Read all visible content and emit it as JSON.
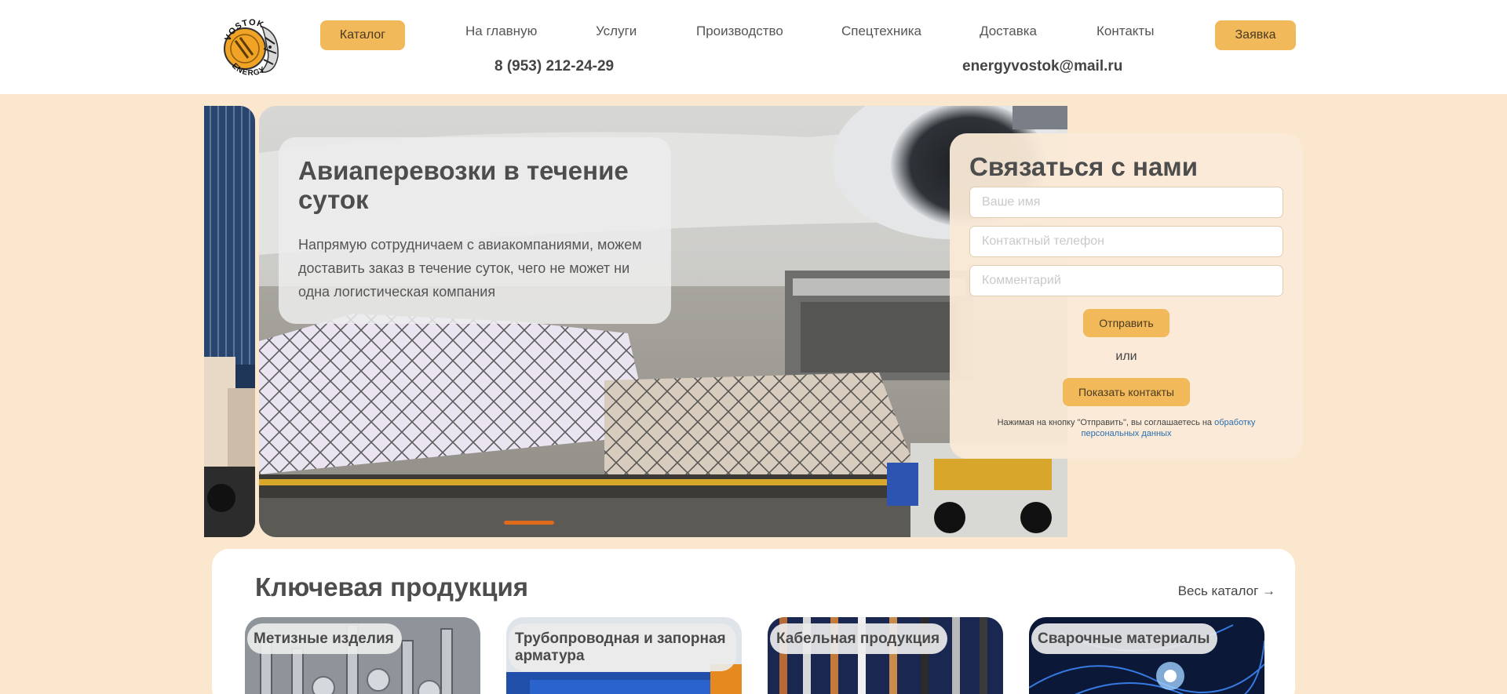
{
  "header": {
    "logo_top": "VOSTOK",
    "logo_bottom": "ENERGY",
    "catalog_label": "Каталог",
    "request_label": "Заявка",
    "nav": [
      "На главную",
      "Услуги",
      "Производство",
      "Спецтехника",
      "Доставка",
      "Контакты"
    ],
    "phone": "8 (953) 212-24-29",
    "email": "energyvostok@mail.ru"
  },
  "hero": {
    "title": "Авиаперевозки в течение суток",
    "text": "Напрямую сотрудничаем с авиакомпаниями, можем доставить заказ в течение суток, чего не может ни одна логистическая компания",
    "slide_count": 1,
    "active_slide": 1
  },
  "contact": {
    "title": "Связаться с нами",
    "name_placeholder": "Ваше имя",
    "phone_placeholder": "Контактный телефон",
    "comment_placeholder": "Комментарий",
    "send_label": "Отправить",
    "or_text": "или",
    "show_contacts_label": "Показать контакты",
    "consent_text": "Нажимая на кнопку \"Отправить\", вы соглашаетесь на ",
    "consent_link": "обработку персональных данных"
  },
  "products": {
    "title": "Ключевая продукция",
    "all_link": "Весь каталог →",
    "cards": [
      {
        "label": "Метизные изделия"
      },
      {
        "label": "Трубопроводная и запорная арматура"
      },
      {
        "label": "Кабельная продукция"
      },
      {
        "label": "Сварочные материалы"
      }
    ]
  },
  "colors": {
    "accent": "#f2b95b",
    "page_bg": "#fbe7cd",
    "slider_active": "#e06a1a",
    "link": "#2a6fb0"
  }
}
